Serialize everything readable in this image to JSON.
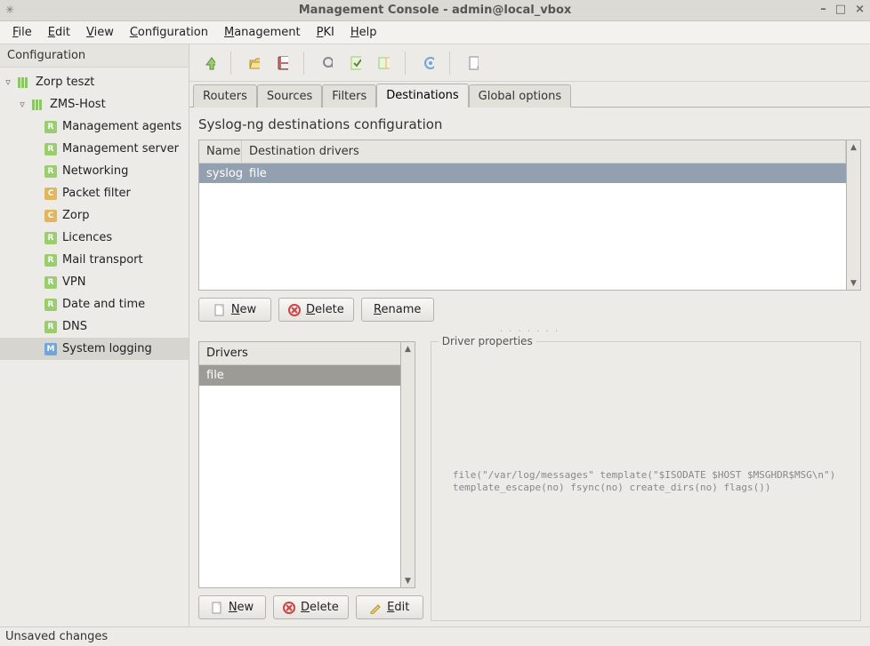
{
  "window": {
    "title": "Management Console - admin@local_vbox"
  },
  "menus": {
    "file": "File",
    "edit": "Edit",
    "view": "View",
    "configuration": "Configuration",
    "management": "Management",
    "pki": "PKI",
    "help": "Help"
  },
  "left_panel": {
    "header": "Configuration",
    "root": "Zorp teszt",
    "host": "ZMS-Host",
    "items": [
      {
        "badge": "R",
        "label": "Management agents"
      },
      {
        "badge": "R",
        "label": "Management server"
      },
      {
        "badge": "R",
        "label": "Networking"
      },
      {
        "badge": "C",
        "label": "Packet filter"
      },
      {
        "badge": "C",
        "label": "Zorp"
      },
      {
        "badge": "R",
        "label": "Licences"
      },
      {
        "badge": "R",
        "label": "Mail transport"
      },
      {
        "badge": "R",
        "label": "VPN"
      },
      {
        "badge": "R",
        "label": "Date and time"
      },
      {
        "badge": "R",
        "label": "DNS"
      },
      {
        "badge": "M",
        "label": "System logging",
        "selected": true
      }
    ]
  },
  "tabs": {
    "routers": "Routers",
    "sources": "Sources",
    "filters": "Filters",
    "destinations": "Destinations",
    "global": "Global options"
  },
  "page": {
    "title": "Syslog-ng destinations configuration"
  },
  "dest_table": {
    "col_name": "Name",
    "col_drivers": "Destination drivers",
    "rows": [
      {
        "name": "syslog",
        "drivers": "file"
      }
    ]
  },
  "buttons": {
    "new": "New",
    "delete": "Delete",
    "rename": "Rename",
    "edit": "Edit"
  },
  "drivers": {
    "header": "Drivers",
    "rows": [
      {
        "label": "file",
        "selected": true
      }
    ]
  },
  "props": {
    "header": "Driver properties",
    "code": "file(\"/var/log/messages\" template(\"$ISODATE $HOST $MSGHDR$MSG\\n\") template_escape(no) fsync(no) create_dirs(no) flags())"
  },
  "status": "Unsaved changes"
}
